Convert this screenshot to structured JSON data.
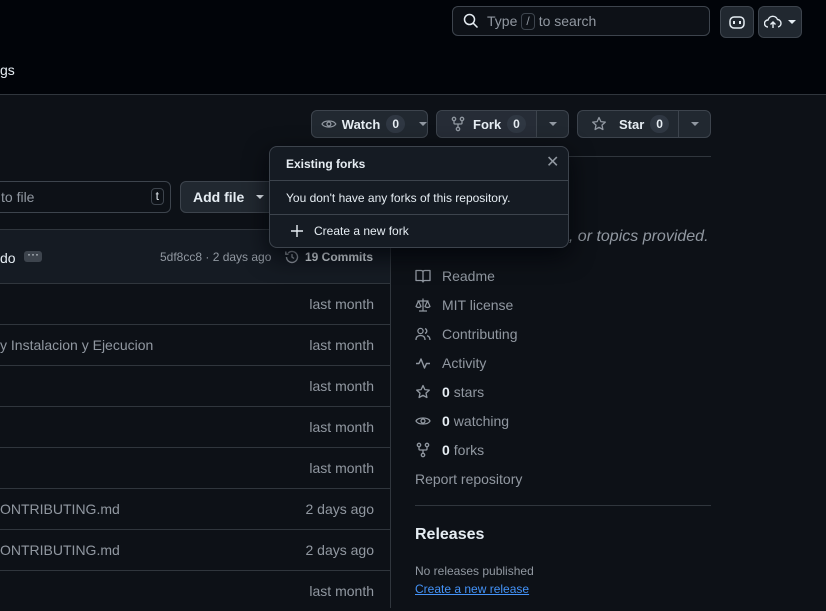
{
  "header": {
    "nav_fragment": "gs",
    "search_prefix": "Type",
    "search_key": "/",
    "search_suffix": "to search"
  },
  "repo_actions": {
    "watch": {
      "label": "Watch",
      "count": "0"
    },
    "fork": {
      "label": "Fork",
      "count": "0"
    },
    "star": {
      "label": "Star",
      "count": "0"
    }
  },
  "file_bar": {
    "go_to_file_placeholder": "to file",
    "go_to_file_key": "t",
    "add_file_label": "Add file"
  },
  "commit_bar": {
    "author_fragment": "do",
    "commit_meta": "5df8cc8 · 2 days ago",
    "commits_label": "19 Commits"
  },
  "files": [
    {
      "name": "",
      "time": "last month"
    },
    {
      "name": "y Instalacion y Ejecucion",
      "time": "last month"
    },
    {
      "name": "",
      "time": "last month"
    },
    {
      "name": "",
      "time": "last month"
    },
    {
      "name": "",
      "time": "last month"
    },
    {
      "name": "ONTRIBUTING.md",
      "time": "2 days ago"
    },
    {
      "name": "ONTRIBUTING.md",
      "time": "2 days ago"
    },
    {
      "name": "",
      "time": "last month"
    }
  ],
  "about": {
    "description_fragment": "e, or topics provided.",
    "links": {
      "readme": "Readme",
      "license": "MIT license",
      "contributing": "Contributing",
      "activity": "Activity"
    },
    "stars": {
      "count": "0",
      "label": "stars"
    },
    "watching": {
      "count": "0",
      "label": "watching"
    },
    "forks": {
      "count": "0",
      "label": "forks"
    },
    "report": "Report repository"
  },
  "releases": {
    "title": "Releases",
    "empty_text": "No releases published",
    "create_link": "Create a new release"
  },
  "forks_popover": {
    "title": "Existing forks",
    "message": "You don't have any forks of this repository.",
    "create_label": "Create a new fork"
  },
  "colors": {
    "background": "#0d1117",
    "header_bg": "#010409",
    "border": "#3d444d",
    "link": "#4493f8",
    "muted": "#9198a1"
  }
}
